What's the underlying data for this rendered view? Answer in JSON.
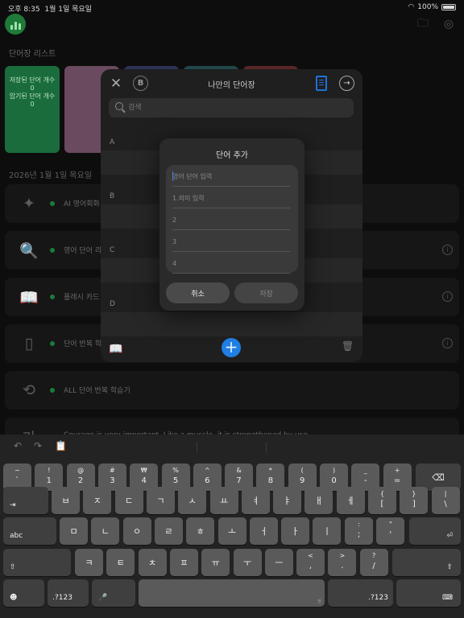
{
  "status": {
    "time": "오후 8:35",
    "date": "1월 1일 목요일",
    "battery": "100%"
  },
  "home": {
    "section_title": "단어장 리스트",
    "green_card": {
      "line1": "저장된 단어 개수",
      "count1": "0",
      "line2": "암기된 단어 개수",
      "count2": "0"
    },
    "date_label": "2026년 1월 1일 목요일",
    "rows": [
      {
        "icon": "sparkle-icon",
        "glyph": "✦",
        "text": "AI 영어회화 학",
        "info": false
      },
      {
        "icon": "word-list-search-icon",
        "glyph": "🔍",
        "text": "영어 단어 리스",
        "info": true
      },
      {
        "icon": "open-book-icon",
        "glyph": "📖",
        "text": "플래시 카드 학",
        "info": true
      },
      {
        "icon": "ipod-icon",
        "glyph": "▯",
        "text": "단어 반복 학습",
        "info": true
      },
      {
        "icon": "repeat-play-icon",
        "glyph": "⟲",
        "text": "ALL 단어 반복 학습기",
        "info": false
      },
      {
        "icon": "translate-icon",
        "glyph": "가",
        "text": "Courage is very important. Like a muscle, it is strengthened by use.",
        "info": false
      }
    ]
  },
  "vocab": {
    "title": "나만의 단어장",
    "b_label": "B",
    "search_placeholder": "검색",
    "sections": [
      "A",
      "B",
      "C",
      "D"
    ]
  },
  "dialog": {
    "title": "단어 추가",
    "fields": [
      {
        "placeholder": "영어 단어 입력"
      },
      {
        "placeholder": "1.의미 입력"
      },
      {
        "placeholder": "2"
      },
      {
        "placeholder": "3"
      },
      {
        "placeholder": "4"
      }
    ],
    "cancel_label": "취소",
    "save_label": "저장"
  },
  "keyboard": {
    "row1": [
      {
        "top": "~",
        "bottom": "`"
      },
      {
        "top": "!",
        "bottom": "1"
      },
      {
        "top": "@",
        "bottom": "2"
      },
      {
        "top": "#",
        "bottom": "3"
      },
      {
        "top": "₩",
        "bottom": "4"
      },
      {
        "top": "%",
        "bottom": "5"
      },
      {
        "top": "^",
        "bottom": "6"
      },
      {
        "top": "&",
        "bottom": "7"
      },
      {
        "top": "*",
        "bottom": "8"
      },
      {
        "top": "(",
        "bottom": "9"
      },
      {
        "top": ")",
        "bottom": "0"
      },
      {
        "top": "_",
        "bottom": "-"
      },
      {
        "top": "+",
        "bottom": "="
      }
    ],
    "row2": [
      "ㅂ",
      "ㅈ",
      "ㄷ",
      "ㄱ",
      "ㅅ",
      "ㅛ",
      "ㅕ",
      "ㅑ",
      "ㅐ",
      "ㅔ"
    ],
    "row2_extra": [
      {
        "top": "{",
        "bottom": "["
      },
      {
        "top": "}",
        "bottom": "]"
      },
      {
        "top": "|",
        "bottom": "\\"
      }
    ],
    "row3": [
      "ㅁ",
      "ㄴ",
      "ㅇ",
      "ㄹ",
      "ㅎ",
      "ㅗ",
      "ㅓ",
      "ㅏ",
      "ㅣ"
    ],
    "row3_extra": [
      {
        "top": ":",
        "bottom": ";"
      },
      {
        "top": "\"",
        "bottom": "'"
      }
    ],
    "row4": [
      "ㅋ",
      "ㅌ",
      "ㅊ",
      "ㅍ",
      "ㅠ",
      "ㅜ",
      "ㅡ"
    ],
    "row4_extra": [
      {
        "top": "<",
        "bottom": ","
      },
      {
        "top": ">",
        "bottom": "."
      },
      {
        "top": "?",
        "bottom": "/"
      }
    ],
    "abc_label": "abc",
    "num_label": ".?123",
    "space_corner": "한"
  }
}
